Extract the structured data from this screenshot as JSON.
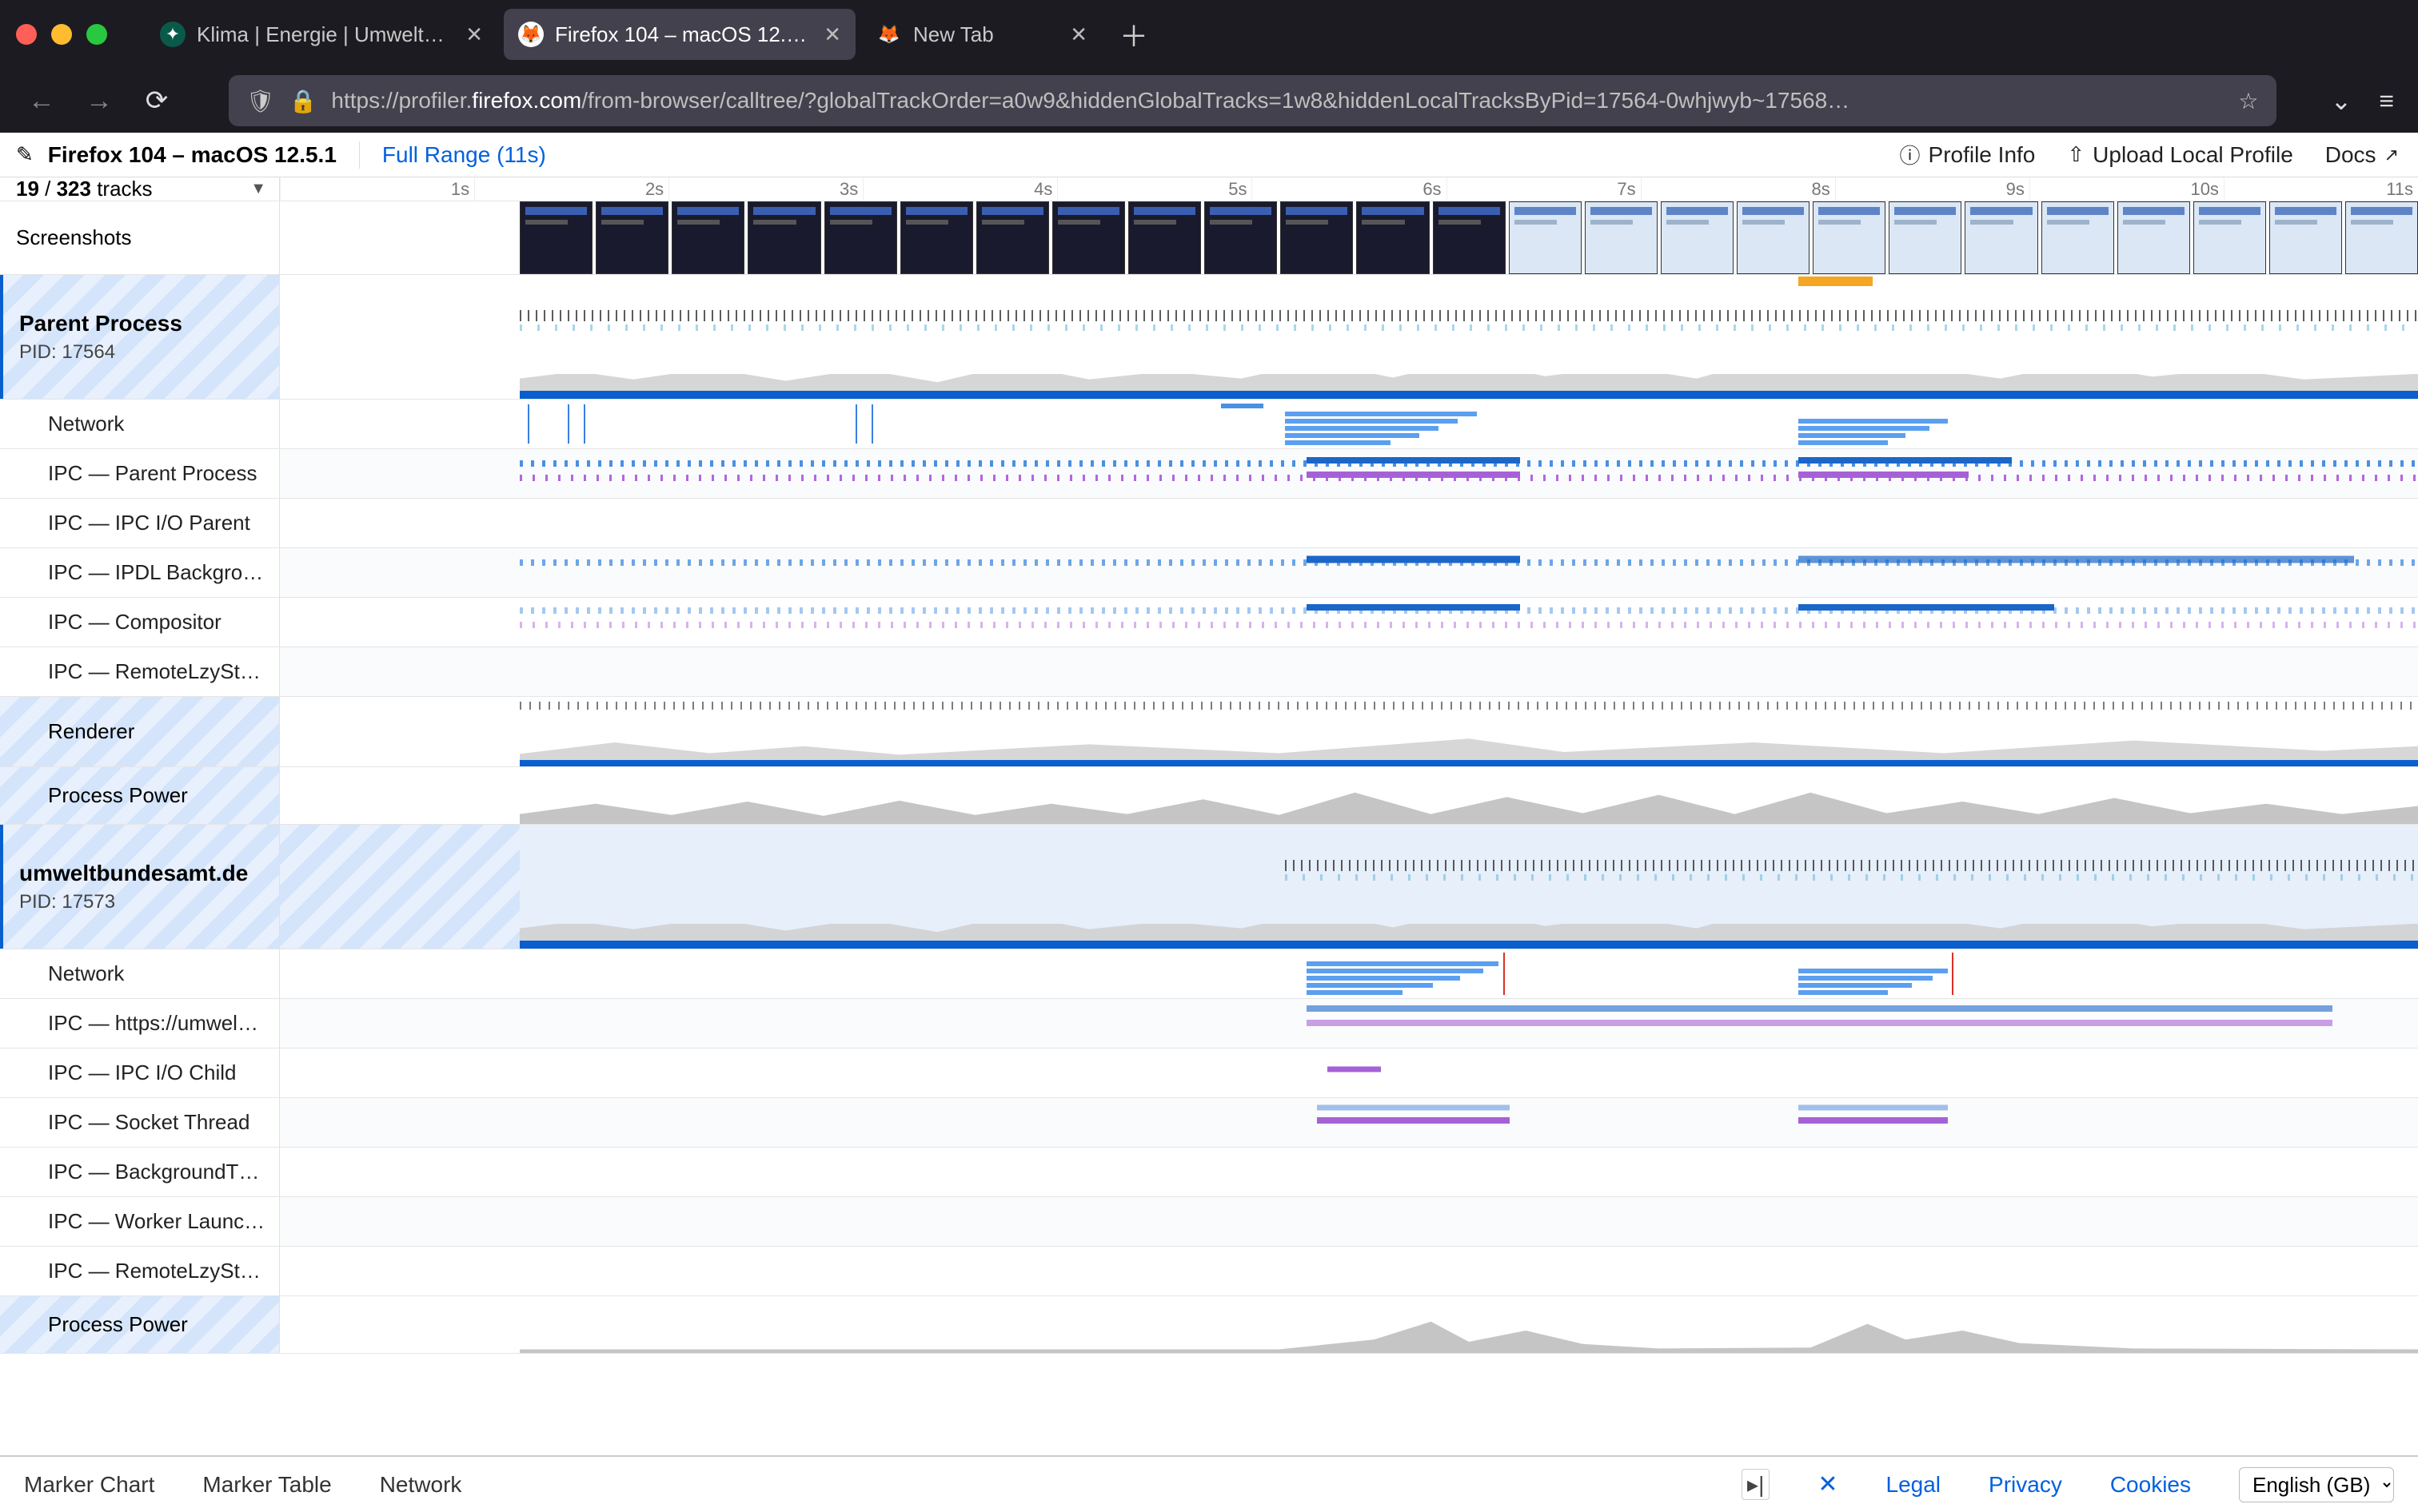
{
  "browser": {
    "tabs": [
      {
        "label": "Klima | Energie | Umweltbundes…",
        "active": false
      },
      {
        "label": "Firefox 104 – macOS 12.5.1 – 27…",
        "active": true
      },
      {
        "label": "New Tab",
        "active": false
      }
    ],
    "url_pre": "https://profiler.",
    "url_host": "firefox.com",
    "url_post": "/from-browser/calltree/?globalTrackOrder=a0w9&hiddenGlobalTracks=1w8&hiddenLocalTracksByPid=17564-0whjwyb~17568…"
  },
  "profiler_header": {
    "name": "Firefox 104 – macOS 12.5.1",
    "range": "Full Range (11s)",
    "profile_info": "Profile Info",
    "upload": "Upload Local Profile",
    "docs": "Docs"
  },
  "tracks_header": {
    "shown": "19",
    "total": "323",
    "suffix": " tracks"
  },
  "ruler": [
    "1s",
    "2s",
    "3s",
    "4s",
    "5s",
    "6s",
    "7s",
    "8s",
    "9s",
    "10s",
    "11s"
  ],
  "screenshots_label": "Screenshots",
  "processes": [
    {
      "name": "Parent Process",
      "pid": "PID: 17564",
      "selected": false,
      "subs": [
        "Network",
        "IPC — Parent Process",
        "IPC — IPC I/O Parent",
        "IPC — IPDL Backgro…",
        "IPC — Compositor",
        "IPC — RemoteLzySt…"
      ],
      "renderer_label": "Renderer",
      "power_label": "Process Power"
    },
    {
      "name": "umweltbundesamt.de",
      "pid": "PID: 17573",
      "selected": true,
      "subs": [
        "Network",
        "IPC — https://umwel…",
        "IPC — IPC I/O Child",
        "IPC — Socket Thread",
        "IPC — BackgroundT…",
        "IPC — Worker Launc…",
        "IPC — RemoteLzySt…"
      ],
      "power_label": "Process Power"
    }
  ],
  "bottom": {
    "views": [
      "Marker Chart",
      "Marker Table",
      "Network"
    ],
    "links": [
      "Legal",
      "Privacy",
      "Cookies"
    ],
    "lang": "English (GB)"
  }
}
